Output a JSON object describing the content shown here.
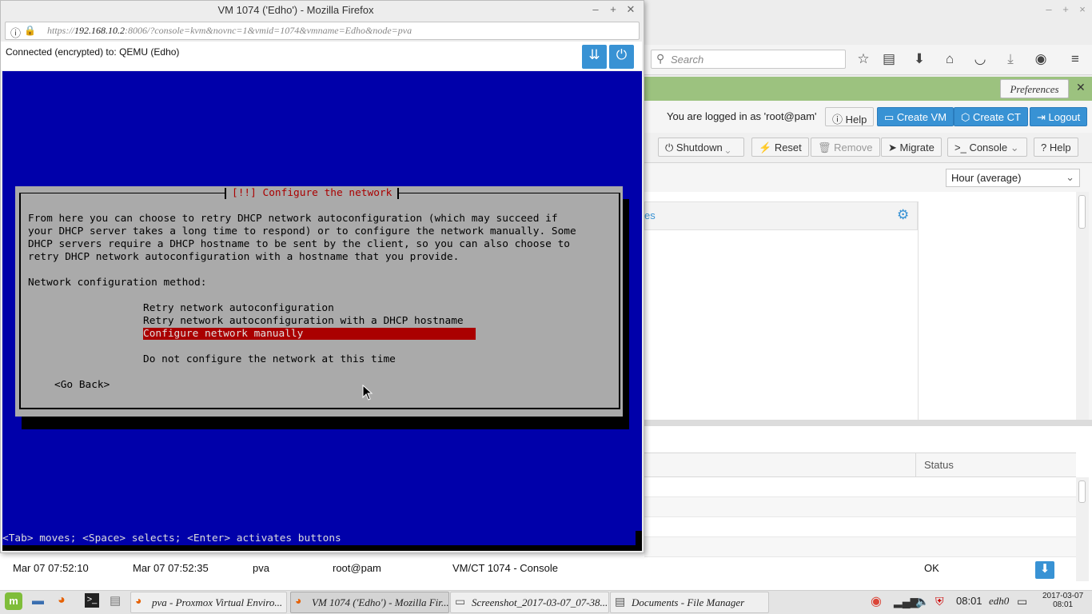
{
  "main_window": {
    "search_placeholder": "Search",
    "preferences_label": "Preferences",
    "logged_in_text": "You are logged in as 'root@pam'",
    "help_label": "Help",
    "create_vm_label": "Create VM",
    "create_ct_label": "Create CT",
    "logout_label": "Logout",
    "shutdown_label": "Shutdown",
    "reset_label": "Reset",
    "remove_label": "Remove",
    "migrate_label": "Migrate",
    "console_label": "Console",
    "help2_label": "Help",
    "timeframe_value": "Hour (average)",
    "panel_heading_fragment": "es",
    "log_status_header": "Status",
    "log_row": {
      "start_time": "Mar 07 07:52:10",
      "end_time": "Mar 07 07:52:35",
      "node": "pva",
      "user": "root@pam",
      "description": "VM/CT 1074 - Console",
      "status": "OK"
    }
  },
  "vm_window": {
    "title": "VM 1074 ('Edho') - Mozilla Firefox",
    "url_prefix": "https://",
    "url_host": "192.168.10.2",
    "url_rest": ":8006/?console=kvm&novnc=1&vmid=1074&vmname=Edho&node=pva",
    "connection_status": "Connected (encrypted) to: QEMU (Edho)"
  },
  "installer_dialog": {
    "title": "[!!] Configure the network",
    "description": "From here you can choose to retry DHCP network autoconfiguration (which may succeed if\nyour DHCP server takes a long time to respond) or to configure the network manually. Some\nDHCP servers require a DHCP hostname to be sent by the client, so you can also choose to\nretry DHCP network autoconfiguration with a hostname that you provide.",
    "prompt_label": "Network configuration method:",
    "options": [
      "Retry network autoconfiguration",
      "Retry network autoconfiguration with a DHCP hostname",
      "Configure network manually",
      "Do not configure the network at this time"
    ],
    "selected_index": 2,
    "go_back_label": "<Go Back>",
    "status_help": "<Tab> moves; <Space> selects; <Enter> activates buttons"
  },
  "taskbar": {
    "tasks": [
      "pva - Proxmox Virtual Enviro...",
      "VM 1074 ('Edho') - Mozilla Fir...",
      "Screenshot_2017-03-07_07-38...",
      "Documents - File Manager"
    ],
    "time": "08:01",
    "user": "edh0",
    "date": "2017-03-07",
    "date_time": "08:01"
  },
  "colors": {
    "console_blue": "#0000aa",
    "dialog_grey": "#aaaaaa",
    "highlight_red": "#aa0000",
    "pve_blue": "#3892d4",
    "preferences_bar": "#9cc27f"
  }
}
